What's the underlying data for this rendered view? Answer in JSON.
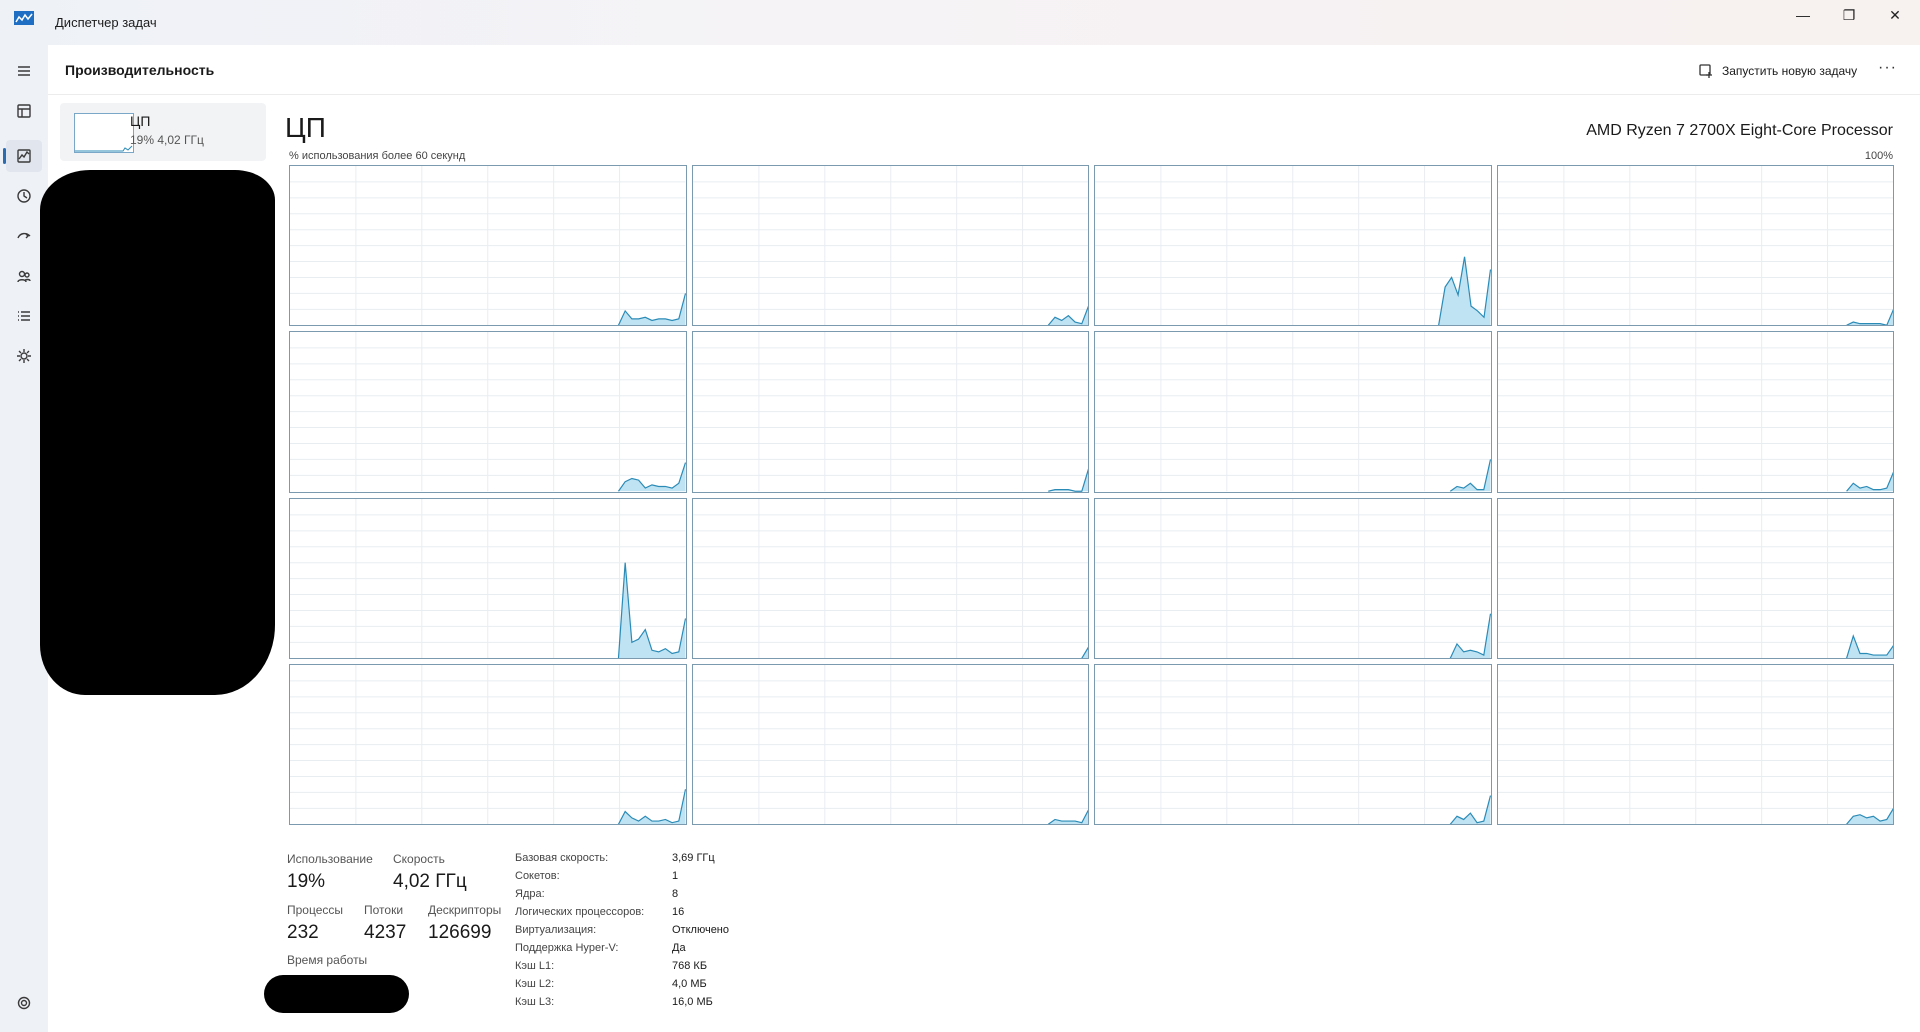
{
  "window": {
    "title": "Диспетчер задач",
    "minimize": "—",
    "maximize": "❐",
    "close": "✕"
  },
  "nav": {
    "items": [
      {
        "icon": "hamburger-menu-icon"
      },
      {
        "icon": "processes-icon"
      },
      {
        "icon": "performance-icon",
        "active": true
      },
      {
        "icon": "app-history-icon"
      },
      {
        "icon": "startup-apps-icon"
      },
      {
        "icon": "users-icon"
      },
      {
        "icon": "details-icon"
      },
      {
        "icon": "services-icon"
      }
    ],
    "settings_icon": "gear-icon"
  },
  "header": {
    "title": "Производительность",
    "run_task_label": "Запустить новую задачу",
    "more_label": "···"
  },
  "sidebar": {
    "cpu_item": {
      "name": "ЦП",
      "sub": "19%  4,02 ГГц"
    }
  },
  "main": {
    "title": "ЦП",
    "model": "AMD Ryzen 7 2700X Eight-Core Processor",
    "graph_caption": "% использования более 60 секунд",
    "graph_max": "100%"
  },
  "chart_data": {
    "type": "area",
    "y_range": [
      0,
      100
    ],
    "x_points": 60,
    "series": [
      {
        "values": [
          0,
          0,
          0,
          0,
          0,
          0,
          0,
          0,
          0,
          0,
          0,
          0,
          0,
          0,
          0,
          0,
          0,
          0,
          0,
          0,
          0,
          0,
          0,
          0,
          0,
          0,
          0,
          0,
          0,
          0,
          0,
          0,
          0,
          0,
          0,
          0,
          0,
          0,
          0,
          0,
          0,
          0,
          0,
          0,
          0,
          0,
          0,
          0,
          0,
          0,
          9,
          4,
          4,
          5,
          3,
          4,
          4,
          3,
          4,
          20
        ]
      },
      {
        "values": [
          0,
          0,
          0,
          0,
          0,
          0,
          0,
          0,
          0,
          0,
          0,
          0,
          0,
          0,
          0,
          0,
          0,
          0,
          0,
          0,
          0,
          0,
          0,
          0,
          0,
          0,
          0,
          0,
          0,
          0,
          0,
          0,
          0,
          0,
          0,
          0,
          0,
          0,
          0,
          0,
          0,
          0,
          0,
          0,
          0,
          0,
          0,
          0,
          0,
          0,
          0,
          0,
          0,
          0,
          5,
          3,
          6,
          2,
          1,
          12
        ]
      },
      {
        "values": [
          0,
          0,
          0,
          0,
          0,
          0,
          0,
          0,
          0,
          0,
          0,
          0,
          0,
          0,
          0,
          0,
          0,
          0,
          0,
          0,
          0,
          0,
          0,
          0,
          0,
          0,
          0,
          0,
          0,
          0,
          0,
          0,
          0,
          0,
          0,
          0,
          0,
          0,
          0,
          0,
          0,
          0,
          0,
          0,
          0,
          0,
          0,
          0,
          0,
          0,
          0,
          0,
          0,
          0,
          24,
          30,
          19,
          43,
          12,
          9,
          5,
          35
        ]
      },
      {
        "values": [
          0,
          0,
          0,
          0,
          0,
          0,
          0,
          0,
          0,
          0,
          0,
          0,
          0,
          0,
          0,
          0,
          0,
          0,
          0,
          0,
          0,
          0,
          0,
          0,
          0,
          0,
          0,
          0,
          0,
          0,
          0,
          0,
          0,
          0,
          0,
          0,
          0,
          0,
          0,
          0,
          0,
          0,
          0,
          0,
          0,
          0,
          0,
          0,
          0,
          0,
          0,
          0,
          0,
          2,
          1,
          1,
          1,
          1,
          0,
          10
        ]
      },
      {
        "values": [
          0,
          0,
          0,
          0,
          0,
          0,
          0,
          0,
          0,
          0,
          0,
          0,
          0,
          0,
          0,
          0,
          0,
          0,
          0,
          0,
          0,
          0,
          0,
          0,
          0,
          0,
          0,
          0,
          0,
          0,
          0,
          0,
          0,
          0,
          0,
          0,
          0,
          0,
          0,
          0,
          0,
          0,
          0,
          0,
          0,
          0,
          0,
          0,
          0,
          0,
          6,
          8,
          7,
          2,
          4,
          3,
          3,
          2,
          5,
          18
        ]
      },
      {
        "values": [
          0,
          0,
          0,
          0,
          0,
          0,
          0,
          0,
          0,
          0,
          0,
          0,
          0,
          0,
          0,
          0,
          0,
          0,
          0,
          0,
          0,
          0,
          0,
          0,
          0,
          0,
          0,
          0,
          0,
          0,
          0,
          0,
          0,
          0,
          0,
          0,
          0,
          0,
          0,
          0,
          0,
          0,
          0,
          0,
          0,
          0,
          0,
          0,
          0,
          0,
          0,
          0,
          0,
          0,
          1,
          1,
          1,
          0,
          0,
          14
        ]
      },
      {
        "values": [
          0,
          0,
          0,
          0,
          0,
          0,
          0,
          0,
          0,
          0,
          0,
          0,
          0,
          0,
          0,
          0,
          0,
          0,
          0,
          0,
          0,
          0,
          0,
          0,
          0,
          0,
          0,
          0,
          0,
          0,
          0,
          0,
          0,
          0,
          0,
          0,
          0,
          0,
          0,
          0,
          0,
          0,
          0,
          0,
          0,
          0,
          0,
          0,
          0,
          0,
          0,
          0,
          0,
          0,
          3,
          2,
          5,
          1,
          1,
          20
        ]
      },
      {
        "values": [
          0,
          0,
          0,
          0,
          0,
          0,
          0,
          0,
          0,
          0,
          0,
          0,
          0,
          0,
          0,
          0,
          0,
          0,
          0,
          0,
          0,
          0,
          0,
          0,
          0,
          0,
          0,
          0,
          0,
          0,
          0,
          0,
          0,
          0,
          0,
          0,
          0,
          0,
          0,
          0,
          0,
          0,
          0,
          0,
          0,
          0,
          0,
          0,
          0,
          0,
          0,
          0,
          0,
          5,
          2,
          3,
          1,
          1,
          2,
          12
        ]
      },
      {
        "values": [
          0,
          0,
          0,
          0,
          0,
          0,
          0,
          0,
          0,
          0,
          0,
          0,
          0,
          0,
          0,
          0,
          0,
          0,
          0,
          0,
          0,
          0,
          0,
          0,
          0,
          0,
          0,
          0,
          0,
          0,
          0,
          0,
          0,
          0,
          0,
          0,
          0,
          0,
          0,
          0,
          0,
          0,
          0,
          0,
          0,
          0,
          0,
          0,
          0,
          0,
          60,
          10,
          12,
          18,
          5,
          4,
          6,
          3,
          4,
          25
        ]
      },
      {
        "values": [
          0,
          0,
          0,
          0,
          0,
          0,
          0,
          0,
          0,
          0,
          0,
          0,
          0,
          0,
          0,
          0,
          0,
          0,
          0,
          0,
          0,
          0,
          0,
          0,
          0,
          0,
          0,
          0,
          0,
          0,
          0,
          0,
          0,
          0,
          0,
          0,
          0,
          0,
          0,
          0,
          0,
          0,
          0,
          0,
          0,
          0,
          0,
          0,
          0,
          0,
          0,
          0,
          0,
          0,
          0,
          0,
          0,
          0,
          0,
          7
        ]
      },
      {
        "values": [
          0,
          0,
          0,
          0,
          0,
          0,
          0,
          0,
          0,
          0,
          0,
          0,
          0,
          0,
          0,
          0,
          0,
          0,
          0,
          0,
          0,
          0,
          0,
          0,
          0,
          0,
          0,
          0,
          0,
          0,
          0,
          0,
          0,
          0,
          0,
          0,
          0,
          0,
          0,
          0,
          0,
          0,
          0,
          0,
          0,
          0,
          0,
          0,
          0,
          0,
          0,
          0,
          0,
          0,
          9,
          4,
          5,
          4,
          2,
          28
        ]
      },
      {
        "values": [
          0,
          0,
          0,
          0,
          0,
          0,
          0,
          0,
          0,
          0,
          0,
          0,
          0,
          0,
          0,
          0,
          0,
          0,
          0,
          0,
          0,
          0,
          0,
          0,
          0,
          0,
          0,
          0,
          0,
          0,
          0,
          0,
          0,
          0,
          0,
          0,
          0,
          0,
          0,
          0,
          0,
          0,
          0,
          0,
          0,
          0,
          0,
          0,
          0,
          0,
          0,
          0,
          0,
          14,
          3,
          3,
          2,
          2,
          2,
          8
        ]
      },
      {
        "values": [
          0,
          0,
          0,
          0,
          0,
          0,
          0,
          0,
          0,
          0,
          0,
          0,
          0,
          0,
          0,
          0,
          0,
          0,
          0,
          0,
          0,
          0,
          0,
          0,
          0,
          0,
          0,
          0,
          0,
          0,
          0,
          0,
          0,
          0,
          0,
          0,
          0,
          0,
          0,
          0,
          0,
          0,
          0,
          0,
          0,
          0,
          0,
          0,
          0,
          0,
          8,
          4,
          2,
          5,
          2,
          2,
          3,
          1,
          2,
          22
        ]
      },
      {
        "values": [
          0,
          0,
          0,
          0,
          0,
          0,
          0,
          0,
          0,
          0,
          0,
          0,
          0,
          0,
          0,
          0,
          0,
          0,
          0,
          0,
          0,
          0,
          0,
          0,
          0,
          0,
          0,
          0,
          0,
          0,
          0,
          0,
          0,
          0,
          0,
          0,
          0,
          0,
          0,
          0,
          0,
          0,
          0,
          0,
          0,
          0,
          0,
          0,
          0,
          0,
          0,
          0,
          0,
          0,
          3,
          2,
          2,
          2,
          1,
          9
        ]
      },
      {
        "values": [
          0,
          0,
          0,
          0,
          0,
          0,
          0,
          0,
          0,
          0,
          0,
          0,
          0,
          0,
          0,
          0,
          0,
          0,
          0,
          0,
          0,
          0,
          0,
          0,
          0,
          0,
          0,
          0,
          0,
          0,
          0,
          0,
          0,
          0,
          0,
          0,
          0,
          0,
          0,
          0,
          0,
          0,
          0,
          0,
          0,
          0,
          0,
          0,
          0,
          0,
          0,
          0,
          0,
          0,
          5,
          3,
          7,
          1,
          2,
          18
        ]
      },
      {
        "values": [
          0,
          0,
          0,
          0,
          0,
          0,
          0,
          0,
          0,
          0,
          0,
          0,
          0,
          0,
          0,
          0,
          0,
          0,
          0,
          0,
          0,
          0,
          0,
          0,
          0,
          0,
          0,
          0,
          0,
          0,
          0,
          0,
          0,
          0,
          0,
          0,
          0,
          0,
          0,
          0,
          0,
          0,
          0,
          0,
          0,
          0,
          0,
          0,
          0,
          0,
          0,
          0,
          0,
          5,
          6,
          4,
          5,
          2,
          3,
          10
        ]
      }
    ],
    "grid": true,
    "colors": {
      "line": "#2b8bb7",
      "fill": "#bfe3f2",
      "grid": "#e8edf1",
      "border": "#7b9ab0"
    }
  },
  "stats": {
    "usage_label": "Использование",
    "usage_value": "19%",
    "speed_label": "Скорость",
    "speed_value": "4,02 ГГц",
    "processes_label": "Процессы",
    "processes_value": "232",
    "threads_label": "Потоки",
    "threads_value": "4237",
    "handles_label": "Дескрипторы",
    "handles_value": "126699",
    "uptime_label": "Время работы"
  },
  "specs": [
    {
      "label": "Базовая скорость:",
      "value": "3,69 ГГц"
    },
    {
      "label": "Сокетов:",
      "value": "1"
    },
    {
      "label": "Ядра:",
      "value": "8"
    },
    {
      "label": "Логических процессоров:",
      "value": "16"
    },
    {
      "label": "Виртуализация:",
      "value": "Отключено"
    },
    {
      "label": "Поддержка Hyper-V:",
      "value": "Да"
    },
    {
      "label": "Кэш L1:",
      "value": "768 КБ"
    },
    {
      "label": "Кэш L2:",
      "value": "4,0 МБ"
    },
    {
      "label": "Кэш L3:",
      "value": "16,0 МБ"
    }
  ]
}
